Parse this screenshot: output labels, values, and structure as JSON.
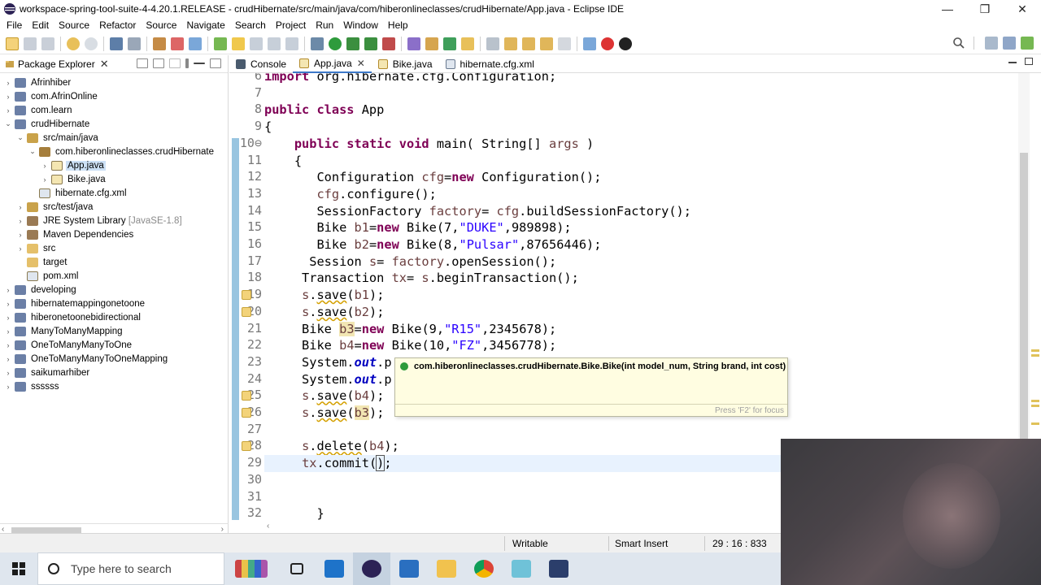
{
  "window": {
    "title": "workspace-spring-tool-suite-4-4.20.1.RELEASE - crudHibernate/src/main/java/com/hiberonlineclasses/crudHibernate/App.java - Eclipse IDE",
    "minimize": "—",
    "restore": "❐",
    "close": "✕"
  },
  "menu": [
    "File",
    "Edit",
    "Source",
    "Refactor",
    "Source",
    "Navigate",
    "Search",
    "Project",
    "Run",
    "Window",
    "Help"
  ],
  "package_explorer": {
    "title": "Package Explorer",
    "close": "✕",
    "tree": [
      {
        "label": "Afrinhiber",
        "indent": 0,
        "twisty": "›",
        "icon": "project-icon"
      },
      {
        "label": "com.AfrinOnline",
        "indent": 0,
        "twisty": "›",
        "icon": "project-icon"
      },
      {
        "label": "com.learn",
        "indent": 0,
        "twisty": "›",
        "icon": "project-icon"
      },
      {
        "label": "crudHibernate",
        "indent": 0,
        "twisty": "⌄",
        "icon": "project-icon"
      },
      {
        "label": "src/main/java",
        "indent": 1,
        "twisty": "⌄",
        "icon": "source-folder-icon"
      },
      {
        "label": "com.hiberonlineclasses.crudHibernate",
        "indent": 2,
        "twisty": "⌄",
        "icon": "package-icon"
      },
      {
        "label": "App.java",
        "indent": 3,
        "twisty": "›",
        "icon": "java-file-icon",
        "selected": true
      },
      {
        "label": "Bike.java",
        "indent": 3,
        "twisty": "›",
        "icon": "java-file-icon"
      },
      {
        "label": "hibernate.cfg.xml",
        "indent": 2,
        "twisty": "",
        "icon": "xml-file-icon"
      },
      {
        "label": "src/test/java",
        "indent": 1,
        "twisty": "›",
        "icon": "source-folder-icon"
      },
      {
        "label": "JRE System Library",
        "dim": "[JavaSE-1.8]",
        "indent": 1,
        "twisty": "›",
        "icon": "library-icon"
      },
      {
        "label": "Maven Dependencies",
        "indent": 1,
        "twisty": "›",
        "icon": "library-icon"
      },
      {
        "label": "src",
        "indent": 1,
        "twisty": "›",
        "icon": "folder-icon"
      },
      {
        "label": "target",
        "indent": 1,
        "twisty": "",
        "icon": "folder-icon"
      },
      {
        "label": "pom.xml",
        "indent": 1,
        "twisty": "",
        "icon": "xml-file-icon"
      },
      {
        "label": "developing",
        "indent": 0,
        "twisty": "›",
        "icon": "project-icon"
      },
      {
        "label": "hibernatemappingonetoone",
        "indent": 0,
        "twisty": "›",
        "icon": "project-icon"
      },
      {
        "label": "hiberonetoonebidirectional",
        "indent": 0,
        "twisty": "›",
        "icon": "project-icon"
      },
      {
        "label": "ManyToManyMapping",
        "indent": 0,
        "twisty": "›",
        "icon": "project-icon"
      },
      {
        "label": "OneToManyManyToOne",
        "indent": 0,
        "twisty": "›",
        "icon": "project-icon"
      },
      {
        "label": "OneToManyManyToOneMapping",
        "indent": 0,
        "twisty": "›",
        "icon": "project-icon"
      },
      {
        "label": "saikumarhiber",
        "indent": 0,
        "twisty": "›",
        "icon": "project-icon"
      },
      {
        "label": "ssssss",
        "indent": 0,
        "twisty": "›",
        "icon": "project-icon"
      }
    ]
  },
  "tabs": [
    {
      "label": "Console",
      "icon": "console-icon",
      "close": ""
    },
    {
      "label": "App.java",
      "icon": "java-file-icon",
      "close": "✕",
      "active": true
    },
    {
      "label": "Bike.java",
      "icon": "java-file-icon",
      "close": ""
    },
    {
      "label": "hibernate.cfg.xml",
      "icon": "xml-file-icon",
      "close": ""
    }
  ],
  "editor": {
    "lines": [
      {
        "n": "6",
        "html": "<span class=\"kw\">import</span> org.hibernate.cfg.Configuration;"
      },
      {
        "n": "7",
        "html": ""
      },
      {
        "n": "8",
        "html": "<span class=\"kw\">public class</span> App"
      },
      {
        "n": "9",
        "html": "{"
      },
      {
        "n": "10⊖",
        "html": "    <span class=\"kw\">public static void</span> main( String[] <span class=\"var\">args</span> )"
      },
      {
        "n": "11",
        "html": "    {"
      },
      {
        "n": "12",
        "html": "       Configuration <span class=\"var\">cfg</span>=<span class=\"kw\">new</span> Configuration();"
      },
      {
        "n": "13",
        "html": "       <span class=\"var\">cfg</span>.configure();"
      },
      {
        "n": "14",
        "html": "       SessionFactory <span class=\"var\">factory</span>= <span class=\"var\">cfg</span>.buildSessionFactory();"
      },
      {
        "n": "15",
        "html": "       Bike <span class=\"var\">b1</span>=<span class=\"kw\">new</span> Bike(7,<span class=\"str\">\"DUKE\"</span>,989898);"
      },
      {
        "n": "16",
        "html": "       Bike <span class=\"var\">b2</span>=<span class=\"kw\">new</span> Bike(8,<span class=\"str\">\"Pulsar\"</span>,87656446);"
      },
      {
        "n": "17",
        "html": "      Session <span class=\"var\">s</span>= <span class=\"var\">factory</span>.openSession();"
      },
      {
        "n": "18",
        "html": "     Transaction <span class=\"var\">tx</span>= <span class=\"var\">s</span>.beginTransaction();"
      },
      {
        "n": "19",
        "html": "     <span class=\"var\">s</span>.<span class=\"strike warn\">save</span>(<span class=\"var\">b1</span>);",
        "marker": true
      },
      {
        "n": "20",
        "html": "     <span class=\"var\">s</span>.<span class=\"strike warn\">save</span>(<span class=\"var\">b2</span>);",
        "marker": true
      },
      {
        "n": "21",
        "html": "     Bike <span class=\"var\" style=\"background:#f2e6b3\">b3</span>=<span class=\"kw\">new</span> Bike(9,<span class=\"str\">\"R15\"</span>,2345678);"
      },
      {
        "n": "22",
        "html": "     Bike <span class=\"var\">b4</span>=<span class=\"kw\">new</span> Bike(10,<span class=\"str\">\"FZ\"</span>,3456778);"
      },
      {
        "n": "23",
        "html": "     System.<span class=\"fld\">out</span>.p"
      },
      {
        "n": "24",
        "html": "     System.<span class=\"fld\">out</span>.p"
      },
      {
        "n": "25",
        "html": "     <span class=\"var\">s</span>.<span class=\"strike warn\">save</span>(<span class=\"var\">b4</span>);",
        "marker": true
      },
      {
        "n": "26",
        "html": "     <span class=\"var\">s</span>.<span class=\"strike warn\">save</span>(<span class=\"var\" style=\"background:#f2e6b3\">b3</span>);",
        "marker": true
      },
      {
        "n": "27",
        "html": ""
      },
      {
        "n": "28",
        "html": "     <span class=\"var\">s</span>.<span class=\"strike warn\">delete</span>(<span class=\"var\">b4</span>);",
        "marker": true
      },
      {
        "n": "29",
        "html": "     <span class=\"var\">tx</span>.commit(<span style=\"outline:1px solid #555\">)</span>;",
        "current": true
      },
      {
        "n": "30",
        "html": ""
      },
      {
        "n": "31",
        "html": ""
      },
      {
        "n": "32",
        "html": "       }"
      }
    ]
  },
  "tooltip": {
    "signature": "com.hiberonlineclasses.crudHibernate.Bike.Bike(int model_num, String brand, int cost)",
    "footer": "Press 'F2' for focus"
  },
  "status": {
    "mode": "Writable",
    "insert": "Smart Insert",
    "position": "29 : 16 : 833"
  },
  "taskbar": {
    "search_placeholder": "Type here to search"
  }
}
